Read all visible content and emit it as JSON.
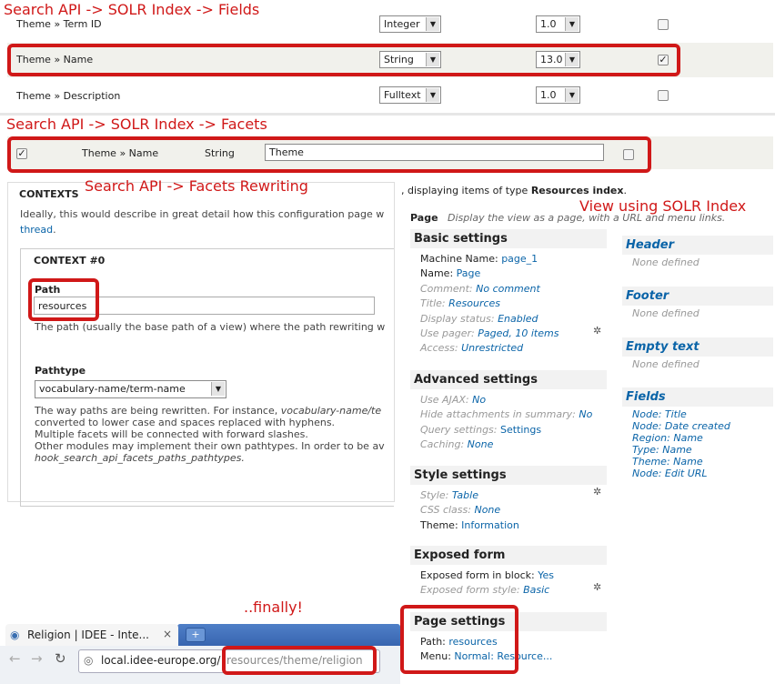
{
  "annotations": {
    "fields": "Search API -> SOLR Index -> Fields",
    "facets": "Search API -> SOLR Index -> Facets",
    "rewriting": "Search API -> Facets Rewriting",
    "view": "View using SOLR Index",
    "finally": "..finally!"
  },
  "fields_table": {
    "rows": [
      {
        "label": "Theme » Term ID",
        "type": "Integer",
        "boost": "1.0",
        "checked": false
      },
      {
        "label": "Theme » Name",
        "type": "String",
        "boost": "13.0",
        "checked": true
      },
      {
        "label": "Theme » Description",
        "type": "Fulltext",
        "boost": "1.0",
        "checked": false
      }
    ]
  },
  "facets_row": {
    "label": "Theme » Name",
    "type": "String",
    "name_value": "Theme"
  },
  "contexts": {
    "title": "CONTEXTS",
    "desc_line1": "Ideally, this would describe in great detail how this configuration page w",
    "desc_link": "thread",
    "desc_after": ".",
    "context_title": "CONTEXT #0",
    "path_label": "Path",
    "path_value": "resources",
    "path_help": "The path (usually the base path of a view) where the path rewriting w",
    "pathtype_label": "Pathtype",
    "pathtype_value": "vocabulary-name/term-name",
    "help1_a": "The way paths are being rewritten. For instance, ",
    "help1_b": "vocabulary-name/te",
    "help2": "converted to lower case and spaces replaced with hyphens.",
    "help3": "Multiple facets will be connected with forward slashes.",
    "help4": "Other modules may implement their own pathtypes. In order to be av",
    "help5": "hook_search_api_facets_paths_pathtypes."
  },
  "view": {
    "intro_a": ", displaying items of type ",
    "intro_b": "Resources index",
    "intro_c": ".",
    "page_label": "Page",
    "page_desc": "Display the view as a page, with a URL and menu links.",
    "basic": {
      "title": "Basic settings",
      "machine_label": "Machine Name:",
      "machine_value": "page_1",
      "name_label": "Name:",
      "name_value": "Page",
      "comment_label": "Comment:",
      "comment_value": "No comment",
      "title_label": "Title:",
      "title_value": "Resources",
      "display_label": "Display status:",
      "display_value": "Enabled",
      "pager_label": "Use pager:",
      "pager_value": "Paged, 10 items",
      "access_label": "Access:",
      "access_value": "Unrestricted"
    },
    "advanced": {
      "title": "Advanced settings",
      "ajax_label": "Use AJAX:",
      "ajax_value": "No",
      "hide_label": "Hide attachments in summary:",
      "hide_value": "No",
      "query_label": "Query settings:",
      "query_value": "Settings",
      "cache_label": "Caching:",
      "cache_value": "None"
    },
    "style": {
      "title": "Style settings",
      "style_label": "Style:",
      "style_value": "Table",
      "css_label": "CSS class:",
      "css_value": "None",
      "theme_label": "Theme:",
      "theme_value": "Information"
    },
    "exposed": {
      "title": "Exposed form",
      "block_label": "Exposed form in block:",
      "block_value": "Yes",
      "style_label": "Exposed form style:",
      "style_value": "Basic"
    },
    "page_settings": {
      "title": "Page settings",
      "path_label": "Path:",
      "path_value": "resources",
      "menu_label": "Menu:",
      "menu_value": "Normal: Resource..."
    },
    "right": {
      "header_title": "Header",
      "header_none": "None defined",
      "footer_title": "Footer",
      "footer_none": "None defined",
      "empty_title": "Empty text",
      "empty_none": "None defined",
      "fields_title": "Fields",
      "fields": [
        "Node: Title",
        "Node: Date created",
        "Region: Name",
        "Type: Name",
        "Theme: Name",
        "Node: Edit URL"
      ]
    }
  },
  "browser": {
    "tab_title": "Religion | IDEE - Inte...",
    "url_host": "local.idee-europe.org/",
    "url_path": "resources/theme/religion"
  }
}
